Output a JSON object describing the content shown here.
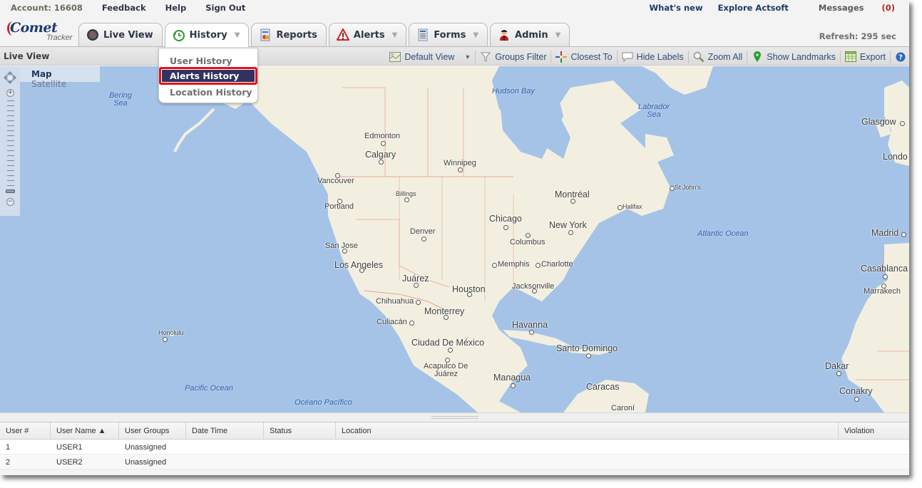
{
  "toplinks": {
    "account": "Account: 16608",
    "feedback": "Feedback",
    "help": "Help",
    "signout": "Sign Out",
    "whatsnew": "What's new",
    "explore": "Explore Actsoft",
    "messages": "Messages",
    "message_count": "(0)"
  },
  "logo": {
    "line1": "Comet",
    "line2": "Tracker"
  },
  "tabs": [
    {
      "label": "Live View",
      "icon": "speedometer-icon",
      "dropdown": false
    },
    {
      "label": "History",
      "icon": "clock-history-icon",
      "dropdown": true,
      "active": true
    },
    {
      "label": "Reports",
      "icon": "report-icon",
      "dropdown": false
    },
    {
      "label": "Alerts",
      "icon": "warning-icon",
      "dropdown": true
    },
    {
      "label": "Forms",
      "icon": "form-document-icon",
      "dropdown": true
    },
    {
      "label": "Admin",
      "icon": "admin-user-icon",
      "dropdown": true
    }
  ],
  "refresh": "Refresh: 295 sec",
  "history_menu": {
    "items": [
      "User History",
      "Alerts History",
      "Location History"
    ],
    "highlighted": "Alerts History"
  },
  "subbar": {
    "title": "Live View",
    "tools": {
      "default_view": "Default View",
      "groups_filter": "Groups Filter",
      "closest_to": "Closest To",
      "hide_labels": "Hide Labels",
      "zoom_all": "Zoom All",
      "show_landmarks": "Show Landmarks",
      "export": "Export"
    }
  },
  "map": {
    "types": {
      "map": "Map",
      "satellite": "Satellite",
      "selected": "Map"
    },
    "water_labels": {
      "bering": "Bering Sea",
      "hudson": "Hudson Bay",
      "labrador": "Labrador Sea",
      "atlantic": "Atlantic Ocean",
      "pacific": "Pacific Ocean",
      "oceano": "Océano Pacífico"
    },
    "cities": {
      "edmonton": "Edmonton",
      "calgary": "Calgary",
      "winnipeg": "Winnipeg",
      "vancouver": "Vancouver",
      "billings": "Billings",
      "portland": "Portland",
      "montreal": "Montréal",
      "stjohns": "St John's",
      "halifax": "Halifax",
      "chicago": "Chicago",
      "newyork": "New York",
      "denver": "Denver",
      "columbus": "Columbus",
      "sanjose": "San Jose",
      "losangeles": "Los Angeles",
      "memphis": "Memphis",
      "charlotte": "Charlotte",
      "juarez": "Juárez",
      "houston": "Houston",
      "jacksonville": "Jacksonville",
      "chihuahua": "Chihuahua",
      "monterrey": "Monterrey",
      "culiacan": "Culiacán",
      "havanna": "Havanna",
      "honolulu": "Honolulu",
      "ciudad": "Ciudad De México",
      "santodomingo": "Santo Domingo",
      "acapulco1": "Acapulco De",
      "acapulco2": "Juárez",
      "managua": "Managua",
      "caracas": "Caracas",
      "caroni": "Caroní",
      "glasgow": "Glasgow",
      "london": "Londo",
      "madrid": "Madrid",
      "casablanca": "Casablanca",
      "marrakech": "Marrakech",
      "dakar": "Dakar",
      "conakry": "Conakry"
    }
  },
  "grid": {
    "columns": [
      "User #",
      "User Name ▲",
      "User Groups",
      "Date Time",
      "Status",
      "Location",
      "Violation"
    ],
    "rows": [
      [
        "1",
        "USER1",
        "Unassigned",
        "",
        "",
        "",
        ""
      ],
      [
        "2",
        "USER2",
        "Unassigned",
        "",
        "",
        "",
        ""
      ]
    ]
  }
}
